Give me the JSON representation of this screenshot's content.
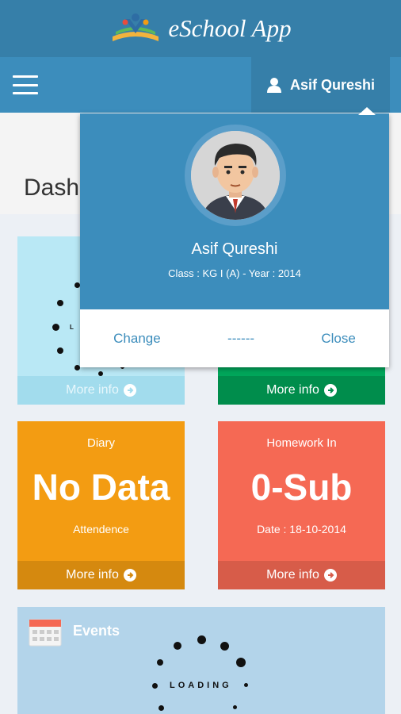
{
  "app": {
    "title": "eSchool App"
  },
  "navbar": {
    "user_name": "Asif Qureshi"
  },
  "page": {
    "title": "Dash"
  },
  "boxes": [
    {
      "footer": "More info"
    },
    {
      "footer": "More info"
    },
    {
      "label": "Diary",
      "value": "No Data",
      "sub": "Attendence",
      "footer": "More info"
    },
    {
      "label": "Homework In",
      "value": "0-Sub",
      "sub": "Date : 18-10-2014",
      "footer": "More info"
    }
  ],
  "events": {
    "title": "Events",
    "loading": "LOADING"
  },
  "spinner": {
    "loading": "L"
  },
  "popup": {
    "name": "Asif Qureshi",
    "class_info": "Class : KG I (A) - Year : 2014",
    "change_label": "Change",
    "separator": "------",
    "close_label": "Close"
  },
  "colors": {
    "header": "#367fa9",
    "navbar": "#3c8dbc",
    "aqua": "#b9e8f5",
    "green": "#00a65a",
    "orange": "#f39c12",
    "red": "#f56954",
    "events": "#b3d4ea"
  }
}
